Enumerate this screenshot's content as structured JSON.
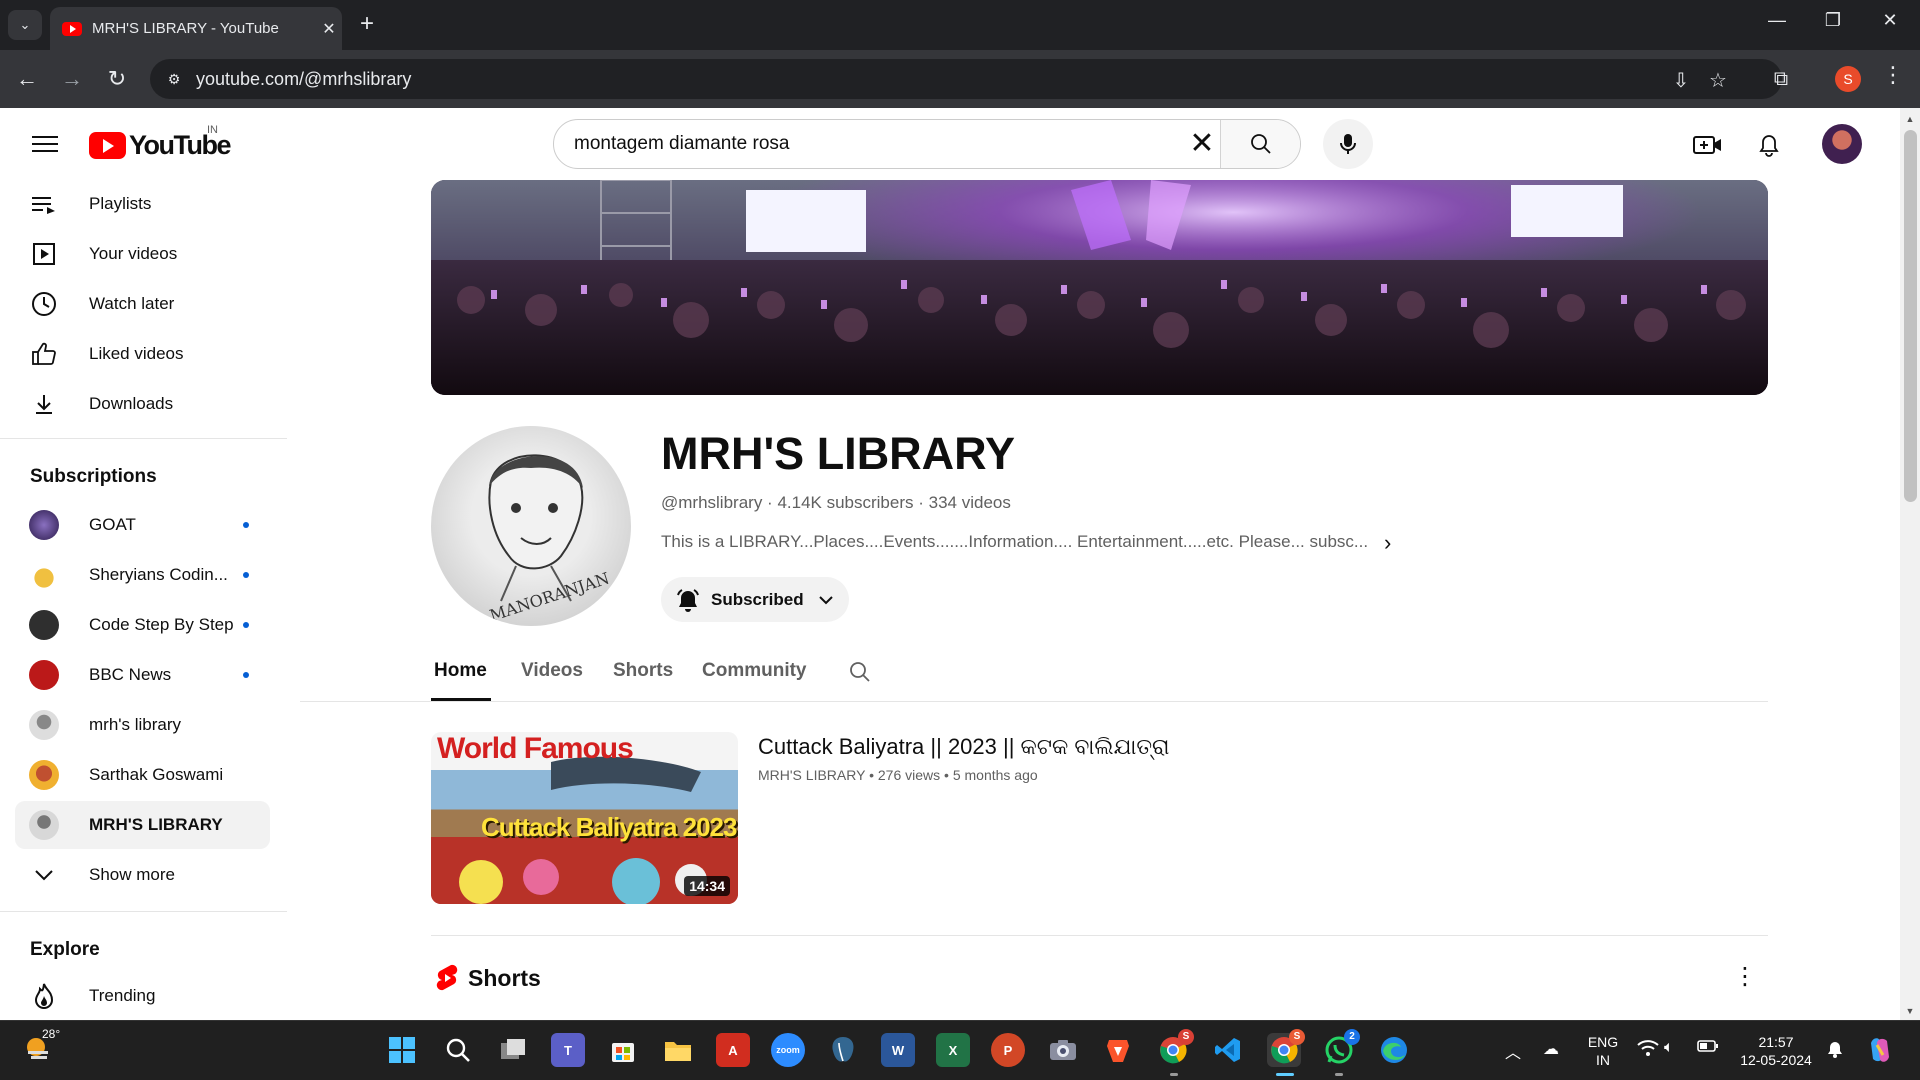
{
  "browser": {
    "tab_title": "MRH'S LIBRARY - YouTube",
    "url": "youtube.com/@mrhslibrary",
    "profile_initial": "S"
  },
  "masthead": {
    "logo_text": "YouTube",
    "country_code": "IN",
    "search_query": "montagem diamante rosa"
  },
  "sidebar": {
    "you_items": [
      {
        "label": "Playlists",
        "icon": "playlists-icon"
      },
      {
        "label": "Your videos",
        "icon": "your-videos-icon"
      },
      {
        "label": "Watch later",
        "icon": "clock-icon"
      },
      {
        "label": "Liked videos",
        "icon": "thumbs-up-icon"
      },
      {
        "label": "Downloads",
        "icon": "download-icon"
      }
    ],
    "subscriptions_heading": "Subscriptions",
    "subscriptions": [
      {
        "label": "GOAT",
        "new": true,
        "color": "#3a2a5a"
      },
      {
        "label": "Sheryians Codin...",
        "new": true,
        "color": "#f4c542"
      },
      {
        "label": "Code Step By Step",
        "new": true,
        "color": "#2a2a2a"
      },
      {
        "label": "BBC News",
        "new": true,
        "color": "#bb1919"
      },
      {
        "label": "mrh's library",
        "new": false,
        "color": "#bdbdbd"
      },
      {
        "label": "Sarthak Goswami",
        "new": false,
        "color": "#e8a020"
      },
      {
        "label": "MRH'S LIBRARY",
        "new": false,
        "color": "#cfcfcf"
      }
    ],
    "show_more": "Show more",
    "explore_heading": "Explore",
    "explore_items": [
      {
        "label": "Trending",
        "icon": "trending-icon"
      }
    ]
  },
  "channel": {
    "name": "MRH'S LIBRARY",
    "handle": "@mrhslibrary",
    "subscribers": "4.14K subscribers",
    "videos": "334 videos",
    "separator": " · ",
    "description": "This is a LIBRARY...Places....Events.......Information.... Entertainment.....etc. Please... subsc...",
    "subscribe_label": "Subscribed",
    "avatar_signature": "MANORANJAN",
    "tabs": [
      "Home",
      "Videos",
      "Shorts",
      "Community"
    ],
    "active_tab": "Home"
  },
  "featured_video": {
    "title": "Cuttack Baliyatra || 2023 || କଟକ ବାଲିଯାତ୍ରା",
    "channel": "MRH'S LIBRARY",
    "views": "276 views",
    "age": "5 months ago",
    "dot": "•",
    "duration": "14:34",
    "thumb_text_top": "World Famous",
    "thumb_text_bottom": "Cuttack Baliyatra 2023"
  },
  "shorts_shelf": {
    "title": "Shorts"
  },
  "taskbar": {
    "temperature": "28°",
    "language": "ENG",
    "region": "IN",
    "time": "21:57",
    "date": "12-05-2024",
    "whatsapp_badge": "2",
    "chrome_badge": "S"
  },
  "colors": {
    "yt_red": "#ff0000",
    "link_blue": "#065fd4",
    "chrome_dark": "#202124",
    "taskbar": "#202020"
  }
}
